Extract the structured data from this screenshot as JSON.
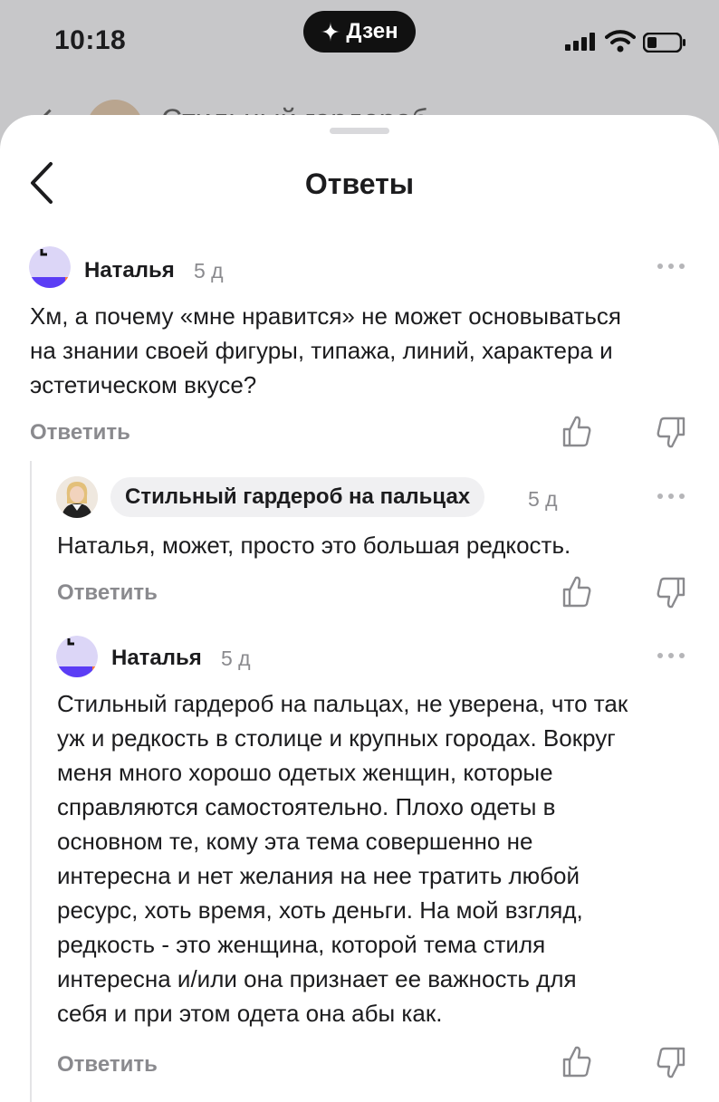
{
  "status_bar": {
    "time": "10:18",
    "app_pill": "Дзен"
  },
  "background": {
    "peek_text": "Стильный гардероб"
  },
  "sheet": {
    "title": "Ответы"
  },
  "comments": [
    {
      "author": "Наталья",
      "time": "5 д",
      "lines": [
        "Хм, а почему «мне нравится» не может основываться",
        "на знании своей фигуры, типажа, линий, характера и",
        "эстетическом вкусе?"
      ],
      "reply_label": "Ответить"
    },
    {
      "author": "Стильный гардероб на пальцах",
      "time": "5 д",
      "lines": [
        "Наталья, может, просто это большая редкость."
      ],
      "reply_label": "Ответить"
    },
    {
      "author": "Наталья",
      "time": "5 д",
      "lines": [
        "Стильный гардероб на пальцах, не уверена, что так",
        "уж и редкость в столице и крупных городах. Вокруг",
        "меня много хорошо одетых женщин, которые",
        "справляются самостоятельно. Плохо одеты в",
        "основном те, кому эта тема совершенно не",
        "интересна и нет желания на нее тратить любой",
        "ресурс, хоть время, хоть деньги. На мой взгляд,",
        "редкость - это женщина, которой тема стиля",
        "интересна и/или она признает ее важность для",
        "себя и при этом одета она абы как."
      ],
      "reply_label": "Ответить"
    }
  ],
  "colors": {
    "accent_purple": "#5b3df5",
    "accent_orange": "#ff7a3d",
    "muted": "#8a8a8e"
  },
  "icons": [
    "dzen-star-icon",
    "signal-icon",
    "wifi-icon",
    "battery-icon",
    "back-chevron-icon",
    "more-icon",
    "thumb-up-icon",
    "thumb-down-icon"
  ]
}
